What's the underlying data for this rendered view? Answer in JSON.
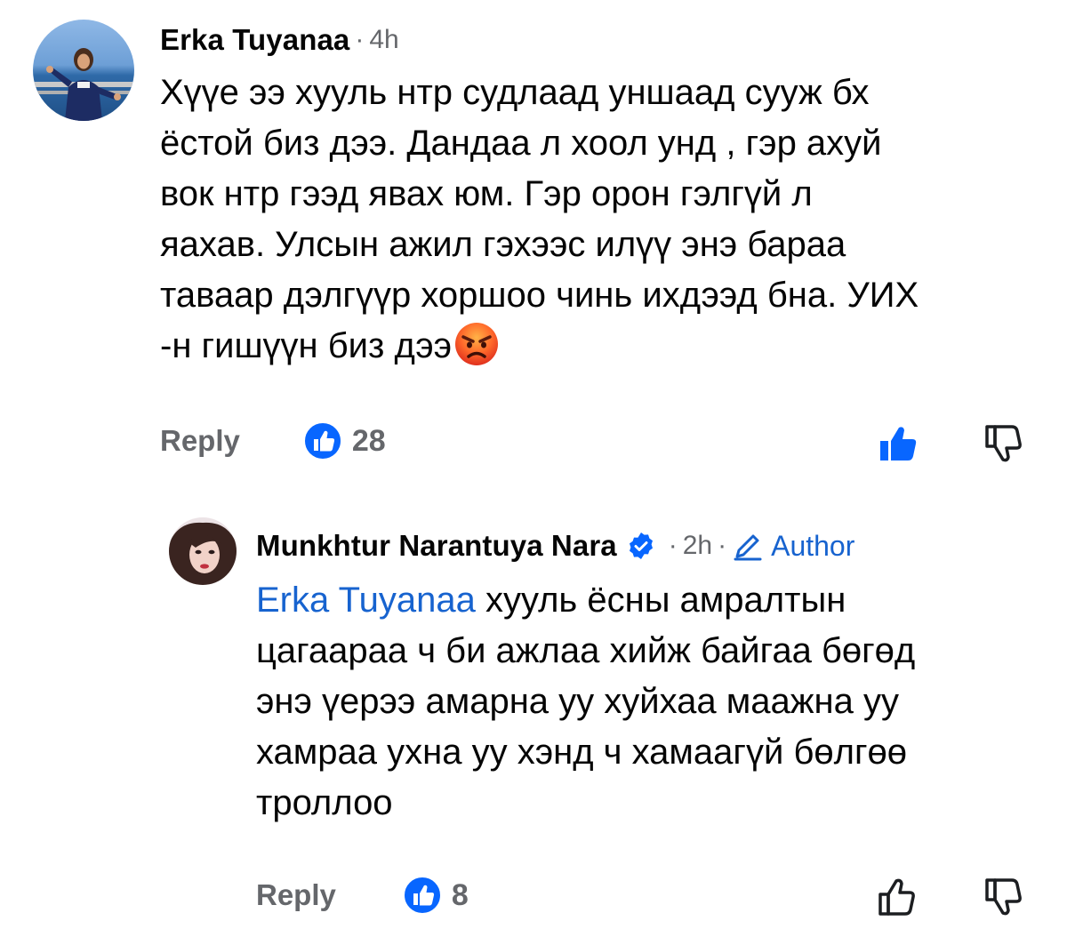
{
  "comments": [
    {
      "author": "Erka Tuyanaa",
      "time": "4h",
      "text": "Хүүе ээ хууль нтр судлаад уншаад сууж бх\nёстой биз дээ. Дандаа л хоол унд , гэр ахуй\nвок нтр гээд явах юм.  Гэр орон гэлгүй л\nяахав.  Улсын ажил гэхээс илүү энэ бараа\nтаваар дэлгүүр хоршоо чинь ихдээд бна. УИХ\n-н гишүүн биз дээ",
      "emoji": "angry-face-icon",
      "reply_label": "Reply",
      "like_count": "28",
      "liked_by_viewer": true
    },
    {
      "author": "Munkhtur Narantuya Nara",
      "verified": true,
      "time": "2h",
      "author_badge": "Author",
      "mention": "Erka Tuyanaa",
      "text": " хууль ёсны амралтын\nцагаараа ч би ажлаа хийж байгаа бөгөд\nэнэ үерээ амарна уу хуйхаа маажна уу\nхамраа ухна уу хэнд ч хамаагүй бөлгөө\nтроллоо",
      "reply_label": "Reply",
      "like_count": "8",
      "liked_by_viewer": false
    }
  ],
  "colors": {
    "link_blue": "#1763cf",
    "like_blue": "#0866ff",
    "muted": "#65676b",
    "text": "#050505"
  },
  "separator": "·"
}
